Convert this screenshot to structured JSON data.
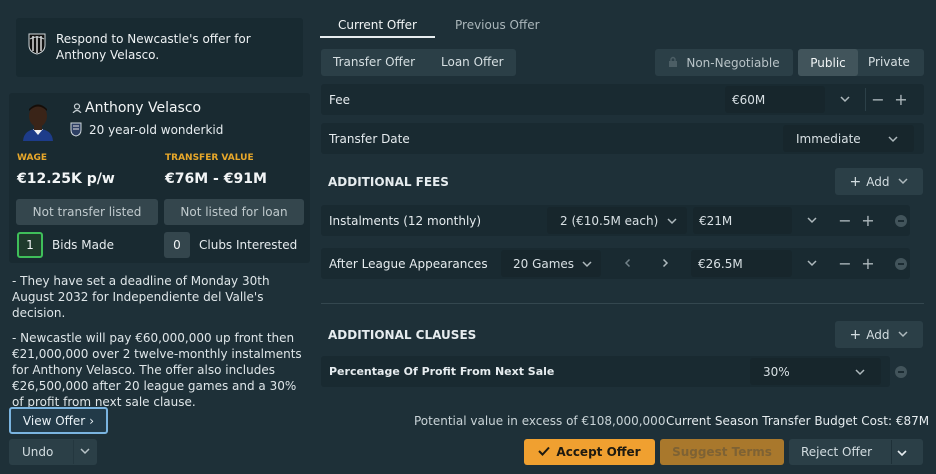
{
  "header": {
    "title": "Respond to Newcastle's offer for Anthony Velasco."
  },
  "player": {
    "name": "Anthony Velasco",
    "subtitle": "20 year-old wonderkid",
    "wage_label": "WAGE",
    "wage_value": "€12.25K p/w",
    "transfer_label": "TRANSFER VALUE",
    "transfer_value": "€76M - €91M",
    "status_transfer": "Not transfer listed",
    "status_loan": "Not listed for loan",
    "bids_count": "1",
    "bids_label": "Bids Made",
    "clubs_count": "0",
    "clubs_label": "Clubs Interested"
  },
  "notes": [
    "- They have set a deadline of Monday 30th August 2032 for Independiente del Valle's decision.",
    "- Newcastle will pay €60,000,000 up front then €21,000,000 over 2 twelve-monthly instalments for Anthony Velasco. The offer also includes €26,500,000 after 20 league games and a 30% of profit from next sale clause."
  ],
  "left_actions": {
    "view_offer": "View Offer",
    "undo": "Undo"
  },
  "tabs": {
    "current": "Current Offer",
    "previous": "Previous Offer"
  },
  "offer_type": {
    "transfer": "Transfer Offer",
    "loan": "Loan Offer"
  },
  "negotiation": {
    "non_negotiable": "Non-Negotiable",
    "public": "Public",
    "private": "Private"
  },
  "fee": {
    "label": "Fee",
    "value": "€60M"
  },
  "transfer_date": {
    "label": "Transfer Date",
    "value": "Immediate"
  },
  "additional_fees": {
    "title": "ADDITIONAL FEES",
    "add_label": "Add",
    "instalments": {
      "label": "Instalments (12 monthly)",
      "option": "2 (€10.5M each)",
      "value": "€21M"
    },
    "appearances": {
      "label": "After League Appearances",
      "option": "20 Games",
      "value": "€26.5M"
    }
  },
  "additional_clauses": {
    "title": "ADDITIONAL CLAUSES",
    "add_label": "Add",
    "sell_on": {
      "label": "Percentage Of Profit From Next Sale",
      "value": "30%"
    }
  },
  "footer": {
    "potential": "Potential value in excess of €108,000,000",
    "budget": "Current Season Transfer Budget Cost: €87M",
    "accept": "Accept Offer",
    "suggest": "Suggest Terms",
    "reject": "Reject Offer"
  },
  "colors": {
    "accent_green": "#3fbf5a",
    "accent_yellow": "#e8a82a",
    "accept_orange": "#f0a030",
    "view_offer_border": "#7ab4e0"
  }
}
